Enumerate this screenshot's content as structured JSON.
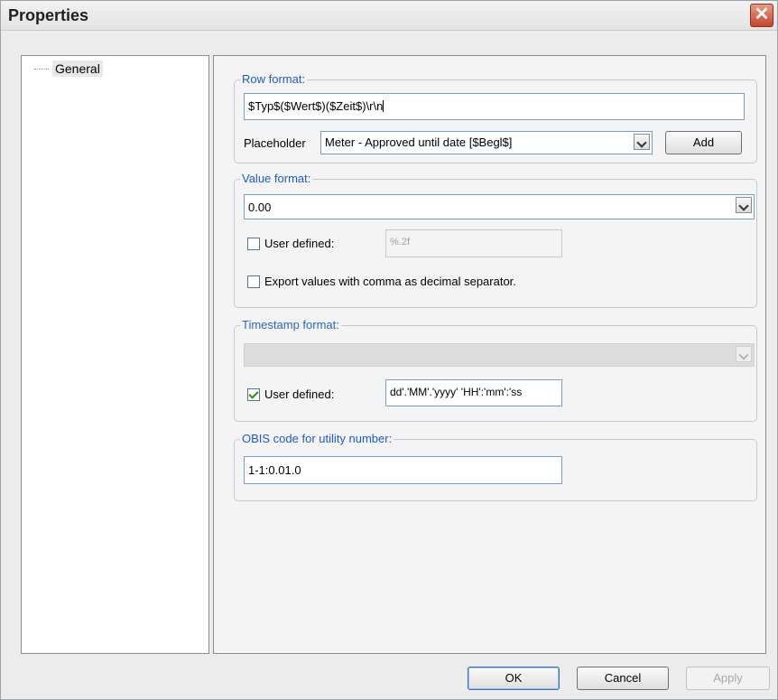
{
  "window": {
    "title": "Properties",
    "close_glyph": "✕"
  },
  "tree": {
    "items": [
      {
        "label": "General"
      }
    ]
  },
  "row_format": {
    "legend": "Row format:",
    "value": "$Typ$($Wert$)($Zeit$)\\r\\n",
    "placeholder_label": "Placeholder",
    "placeholder_selected": "Meter - Approved until date [$Begl$]",
    "add_label": "Add"
  },
  "value_format": {
    "legend": "Value format:",
    "selected": "0.00",
    "user_defined_label": "User defined:",
    "user_defined_checked": false,
    "user_defined_value": "%.2f",
    "export_comma_label": "Export values with comma as decimal separator.",
    "export_comma_checked": false
  },
  "timestamp_format": {
    "legend": "Timestamp format:",
    "selected": "",
    "user_defined_label": "User defined:",
    "user_defined_checked": true,
    "user_defined_value": "dd'.'MM'.'yyyy' 'HH':'mm':'ss"
  },
  "obis": {
    "legend": "OBIS code for utility number:",
    "value": "1-1:0.01.0"
  },
  "buttons": {
    "ok": "OK",
    "cancel": "Cancel",
    "apply": "Apply"
  },
  "icons": {
    "close": "close-icon",
    "dropdown": "chevron-down-icon",
    "checkmark": "checkmark-icon"
  },
  "colors": {
    "legend": "#1c5ac9",
    "close_button": "#c4462b"
  }
}
